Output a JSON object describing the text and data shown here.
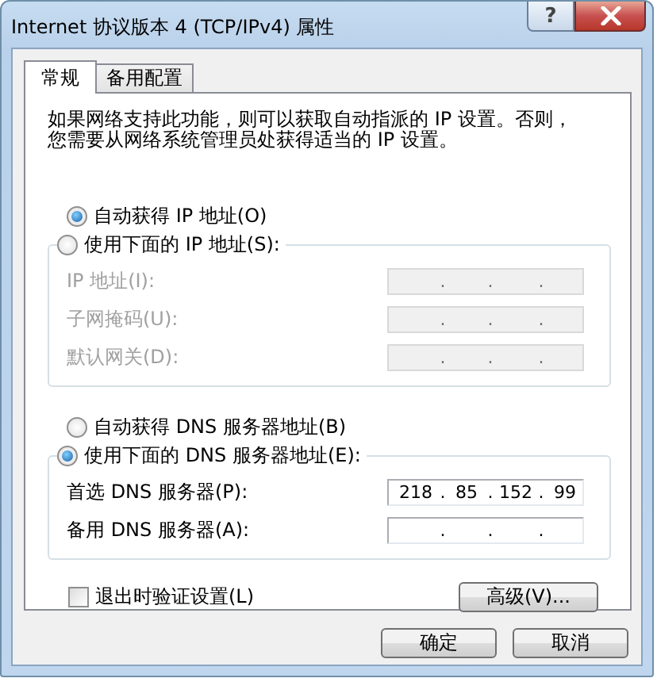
{
  "window": {
    "title": "Internet 协议版本 4 (TCP/IPv4) 属性",
    "help_button": "?"
  },
  "tabs": [
    {
      "label": "常规",
      "selected": true
    },
    {
      "label": "备用配置",
      "selected": false
    }
  ],
  "description": "如果网络支持此功能，则可以获取自动指派的 IP 设置。否则，您需要从网络系统管理员处获得适当的 IP 设置。",
  "ip_section": {
    "auto_radio": {
      "label": "自动获得 IP 地址(O)",
      "selected": true
    },
    "manual_radio": {
      "label": "使用下面的 IP 地址(S):",
      "selected": false
    },
    "disabled": true,
    "fields": [
      {
        "label": "IP 地址(I):",
        "dots": [
          ".",
          ".",
          "."
        ]
      },
      {
        "label": "子网掩码(U):",
        "dots": [
          ".",
          ".",
          "."
        ]
      },
      {
        "label": "默认网关(D):",
        "dots": [
          ".",
          ".",
          "."
        ]
      }
    ]
  },
  "dns_section": {
    "auto_radio": {
      "label": "自动获得 DNS 服务器地址(B)",
      "selected": false
    },
    "manual_radio": {
      "label": "使用下面的 DNS 服务器地址(E):",
      "selected": true
    },
    "disabled": false,
    "fields": [
      {
        "label": "首选 DNS 服务器(P):",
        "dots": [
          ".",
          ".",
          "."
        ],
        "octets": [
          "218",
          "85",
          "152",
          "99"
        ]
      },
      {
        "label": "备用 DNS 服务器(A):",
        "dots": [
          ".",
          ".",
          "."
        ]
      }
    ]
  },
  "validate_checkbox": {
    "label": "退出时验证设置(L)",
    "checked": false
  },
  "advanced_button": "高级(V)...",
  "buttons": [
    "确定",
    "取消"
  ]
}
